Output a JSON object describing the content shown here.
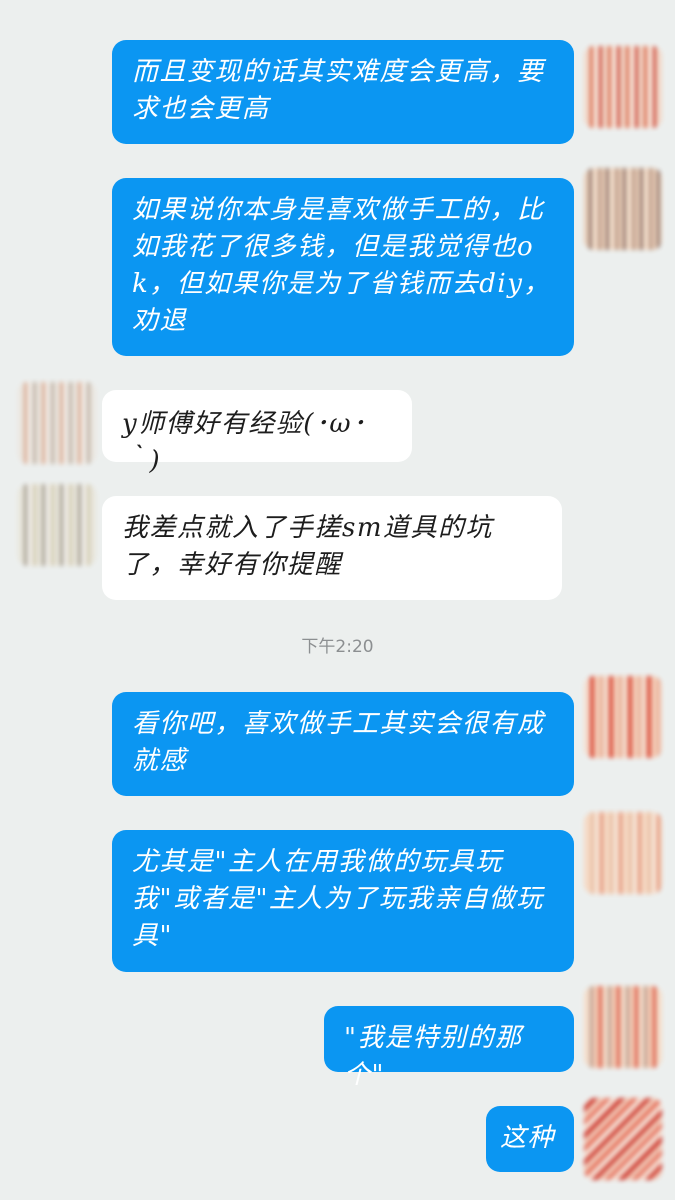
{
  "chat": {
    "messages": [
      {
        "side": "outgoing",
        "text": "而且变现的话其实难度会更高，要求也会更高"
      },
      {
        "side": "outgoing",
        "text": "如果说你本身是喜欢做手工的，比如我花了很多钱，但是我觉得也ok，但如果你是为了省钱而去diy，劝退"
      },
      {
        "side": "incoming",
        "text": "y师傅好有经验(･ω･｀)"
      },
      {
        "side": "incoming",
        "text": "我差点就入了手搓sm道具的坑了，幸好有你提醒"
      },
      {
        "side": "outgoing",
        "text": "看你吧，喜欢做手工其实会很有成就感"
      },
      {
        "side": "outgoing",
        "text": "尤其是\"主人在用我做的玩具玩我\"或者是\"主人为了玩我亲自做玩具\""
      },
      {
        "side": "outgoing",
        "text": "\"我是特别的那个\""
      },
      {
        "side": "outgoing",
        "text": "这种"
      }
    ],
    "timestamp": "下午2:20"
  },
  "colors": {
    "outgoing_bubble": "#0b96f2",
    "incoming_bubble": "#ffffff",
    "background": "#ecefee"
  }
}
